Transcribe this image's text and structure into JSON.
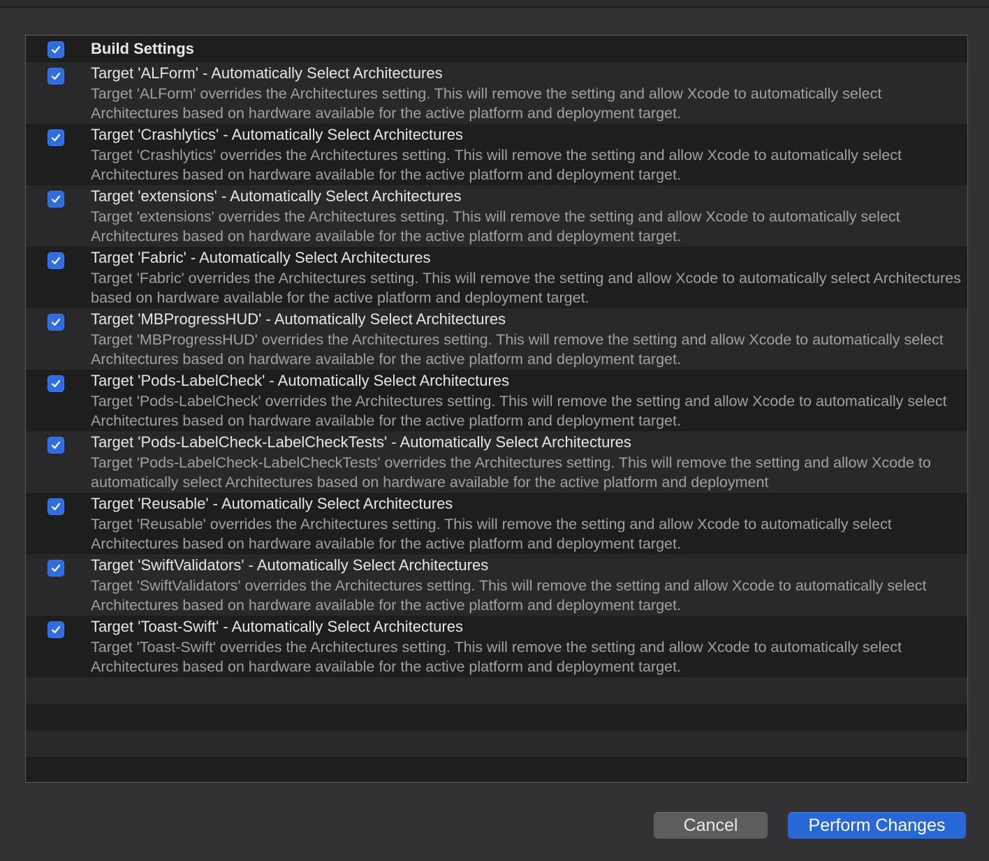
{
  "list": {
    "header": {
      "label": "Build Settings",
      "checked": true
    },
    "items": [
      {
        "title": "Target 'ALForm' - Automatically Select Architectures",
        "description": "Target 'ALForm' overrides the Architectures setting. This will remove the setting and allow Xcode to automatically select Architectures based on hardware available for the active platform and deployment target.",
        "checked": true
      },
      {
        "title": "Target 'Crashlytics' - Automatically Select Architectures",
        "description": "Target 'Crashlytics' overrides the Architectures setting. This will remove the setting and allow Xcode to automatically select Architectures based on hardware available for the active platform and deployment target.",
        "checked": true
      },
      {
        "title": "Target 'extensions' - Automatically Select Architectures",
        "description": "Target 'extensions' overrides the Architectures setting. This will remove the setting and allow Xcode to automatically select Architectures based on hardware available for the active platform and deployment target.",
        "checked": true
      },
      {
        "title": "Target 'Fabric' - Automatically Select Architectures",
        "description": "Target 'Fabric' overrides the Architectures setting. This will remove the setting and allow Xcode to automatically select Architectures based on hardware available for the active platform and deployment target.",
        "checked": true
      },
      {
        "title": "Target 'MBProgressHUD' - Automatically Select Architectures",
        "description": "Target 'MBProgressHUD' overrides the Architectures setting. This will remove the setting and allow Xcode to automatically select Architectures based on hardware available for the active platform and deployment target.",
        "checked": true
      },
      {
        "title": "Target 'Pods-LabelCheck' - Automatically Select Architectures",
        "description": "Target 'Pods-LabelCheck' overrides the Architectures setting. This will remove the setting and allow Xcode to automatically select Architectures based on hardware available for the active platform and deployment target.",
        "checked": true
      },
      {
        "title": "Target 'Pods-LabelCheck-LabelCheckTests' - Automatically Select Architectures",
        "description": "Target 'Pods-LabelCheck-LabelCheckTests' overrides the Architectures setting. This will remove the setting and allow Xcode to automatically select Architectures based on hardware available for the active platform and deployment",
        "checked": true
      },
      {
        "title": "Target 'Reusable' - Automatically Select Architectures",
        "description": "Target 'Reusable' overrides the Architectures setting. This will remove the setting and allow Xcode to automatically select Architectures based on hardware available for the active platform and deployment target.",
        "checked": true
      },
      {
        "title": "Target 'SwiftValidators' - Automatically Select Architectures",
        "description": "Target 'SwiftValidators' overrides the Architectures setting. This will remove the setting and allow Xcode to automatically select Architectures based on hardware available for the active platform and deployment target.",
        "checked": true
      },
      {
        "title": "Target 'Toast-Swift' - Automatically Select Architectures",
        "description": "Target 'Toast-Swift' overrides the Architectures setting. This will remove the setting and allow Xcode to automatically select Architectures based on hardware available for the active platform and deployment target.",
        "checked": true
      }
    ]
  },
  "buttons": {
    "cancel_label": "Cancel",
    "perform_label": "Perform Changes"
  },
  "colors": {
    "accent": "#2f6de1",
    "primary_button": "#2867d6",
    "secondary_button": "#5d5d60"
  },
  "icons": {
    "checkbox": "checkmark-icon"
  }
}
